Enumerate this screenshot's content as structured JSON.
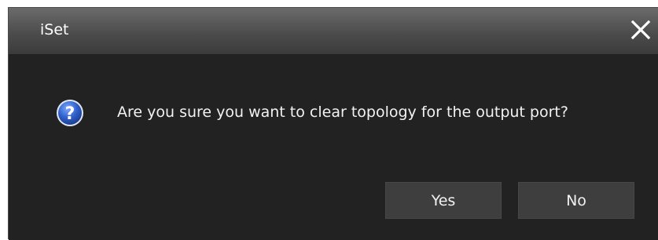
{
  "window": {
    "title": "iSet"
  },
  "dialog": {
    "icon": "question-icon",
    "message": "Are you sure you want to clear topology for the output port?",
    "yes_label": "Yes",
    "no_label": "No"
  },
  "colors": {
    "background": "#222222",
    "titlebar": "#555555",
    "button": "#3e3e3e",
    "text": "#f2f2f2",
    "icon_blue": "#2f5fc9"
  }
}
